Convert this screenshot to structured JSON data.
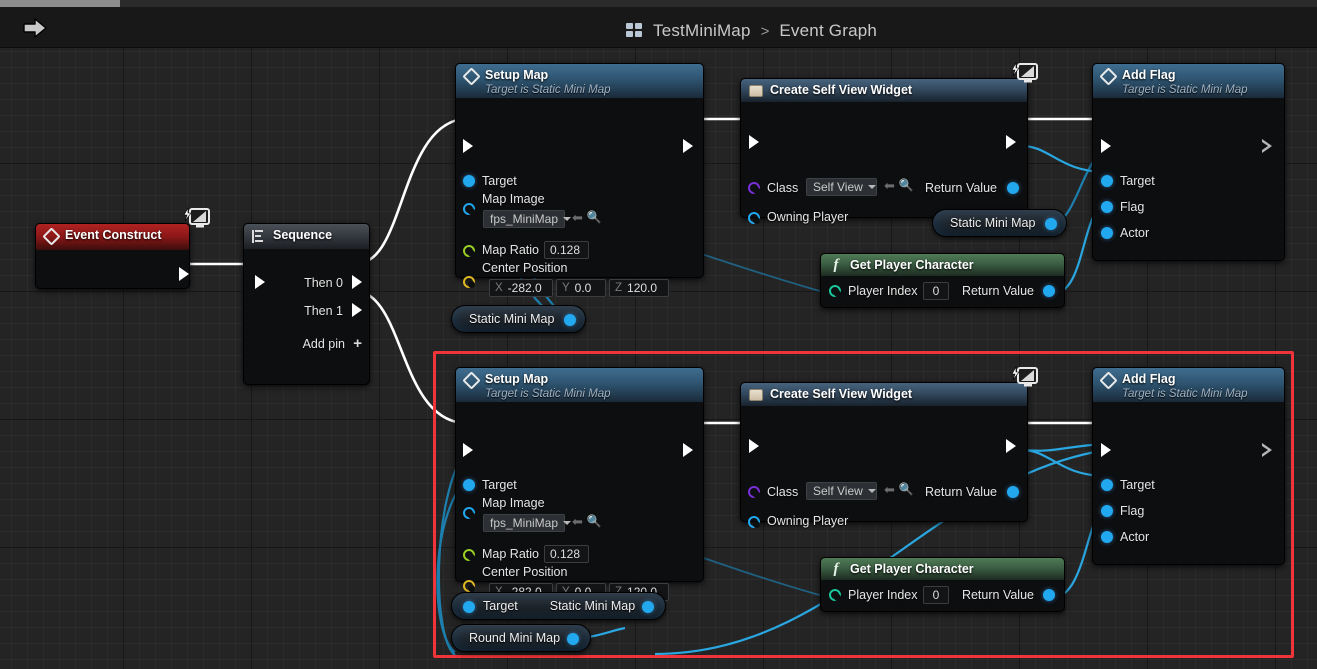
{
  "window": {
    "scrollbar": "horizontal-scrollbar"
  },
  "toolbar": {
    "back_arrow_icon": "forward-arrow-icon",
    "breadcrumb": {
      "icon": "blueprint-grid-icon",
      "asset": "TestMiniMap",
      "separator": ">",
      "graph": "Event Graph"
    }
  },
  "nodes": {
    "event_construct": {
      "title": "Event Construct",
      "icon": "diamond-event-icon",
      "badge": "widget-event-badge"
    },
    "sequence": {
      "title": "Sequence",
      "icon": "sequence-icon",
      "pins": [
        "Then 0",
        "Then 1"
      ],
      "add_pin": "Add pin"
    },
    "setup_map_top": {
      "title": "Setup Map",
      "subtitle": "Target is Static Mini Map",
      "pins": {
        "target": "Target",
        "map_image": "Map Image",
        "map_image_value": "fps_MiniMap",
        "map_ratio": "Map Ratio",
        "map_ratio_value": "0.128",
        "center_position": "Center Position",
        "center_x_axis": "X",
        "center_x": "-282.0",
        "center_y_axis": "Y",
        "center_y": "0.0",
        "center_z_axis": "Z",
        "center_z": "120.0"
      }
    },
    "setup_map_bottom": {
      "title": "Setup Map",
      "subtitle": "Target is Static Mini Map",
      "pins": {
        "target": "Target",
        "map_image": "Map Image",
        "map_image_value": "fps_MiniMap",
        "map_ratio": "Map Ratio",
        "map_ratio_value": "0.128",
        "center_position": "Center Position",
        "center_x_axis": "X",
        "center_x": "-282.0",
        "center_y_axis": "Y",
        "center_y": "0.0",
        "center_z_axis": "Z",
        "center_z": "120.0"
      }
    },
    "create_widget_top": {
      "title": "Create Self View Widget",
      "icon": "widget-icon",
      "badge": "widget-badge",
      "pins": {
        "class": "Class",
        "class_value": "Self View",
        "owning_player": "Owning Player",
        "return_value": "Return Value"
      }
    },
    "create_widget_bottom": {
      "title": "Create Self View Widget",
      "icon": "widget-icon",
      "badge": "widget-badge",
      "pins": {
        "class": "Class",
        "class_value": "Self View",
        "owning_player": "Owning Player",
        "return_value": "Return Value"
      }
    },
    "add_flag_top": {
      "title": "Add Flag",
      "subtitle": "Target is Static Mini Map",
      "pins": {
        "target": "Target",
        "flag": "Flag",
        "actor": "Actor"
      }
    },
    "add_flag_bottom": {
      "title": "Add Flag",
      "subtitle": "Target is Static Mini Map",
      "pins": {
        "target": "Target",
        "flag": "Flag",
        "actor": "Actor"
      }
    },
    "get_player_character_top": {
      "title": "Get Player Character",
      "icon": "function-icon",
      "pins": {
        "player_index": "Player Index",
        "player_index_value": "0",
        "return_value": "Return Value"
      }
    },
    "get_player_character_bottom": {
      "title": "Get Player Character",
      "icon": "function-icon",
      "pins": {
        "player_index": "Player Index",
        "player_index_value": "0",
        "return_value": "Return Value"
      }
    },
    "var_static_mini_map_top": {
      "label": "Static Mini Map"
    },
    "var_static_mini_map_mid": {
      "label": "Static Mini Map"
    },
    "var_static_mini_map_bottom": {
      "in_label": "Target",
      "label": "Static Mini Map"
    },
    "var_round_mini_map": {
      "label": "Round Mini Map"
    }
  },
  "annotations": {
    "selection_rect": "red-highlight-rectangle"
  },
  "colors": {
    "accent_red": "#f0343a",
    "exec_wire": "#ffffff",
    "object_wire": "#2aa6e0",
    "canvas": "#242424",
    "node_body": "#0d0e10",
    "header_blue": "#2e5470",
    "header_green": "#3b5e42",
    "header_red": "#8a1717",
    "pin_object": "#22a8ef",
    "pin_class": "#7a2fd8",
    "pin_float": "#9ad124",
    "pin_vector": "#e0b820",
    "pin_int": "#19c79a"
  }
}
